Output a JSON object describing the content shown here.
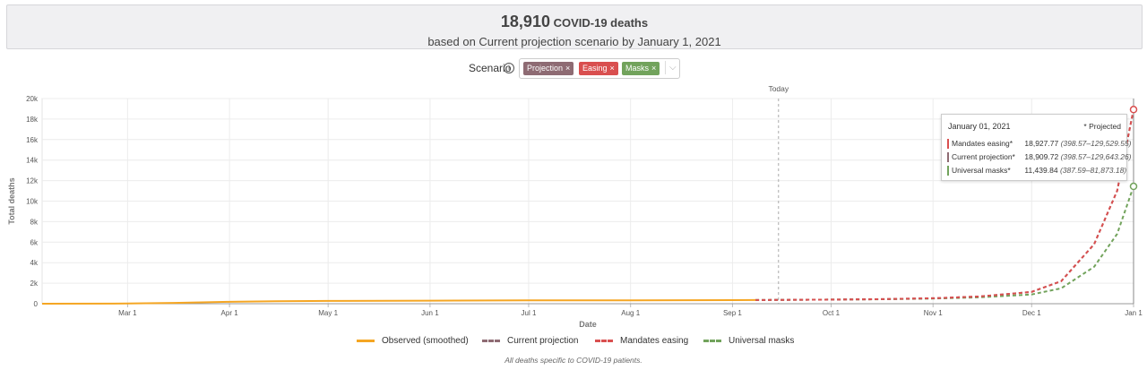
{
  "summary": {
    "value": "18,910",
    "metric": "COVID-19 deaths",
    "subtitle": "based on Current projection scenario by January 1, 2021"
  },
  "scenario": {
    "label": "Scenario",
    "info_icon": "info-icon",
    "tags": [
      {
        "label": "Projection",
        "color": "#8e6b73"
      },
      {
        "label": "Easing",
        "color": "#d94f4f"
      },
      {
        "label": "Masks",
        "color": "#72a35c"
      }
    ],
    "remove_glyph": "×",
    "dropdown_icon": "chevron-down-icon"
  },
  "tooltip": {
    "date": "January 01, 2021",
    "note": "* Projected",
    "rows": [
      {
        "name": "Mandates easing*",
        "value": "18,927.77",
        "ci": "(398.57–129,529.55)",
        "color": "#d94f4f"
      },
      {
        "name": "Current projection*",
        "value": "18,909.72",
        "ci": "(398.57–129,643.26)",
        "color": "#8e6b73"
      },
      {
        "name": "Universal masks*",
        "value": "11,439.84",
        "ci": "(387.59–81,873.18)",
        "color": "#72a35c"
      }
    ]
  },
  "legend": [
    {
      "label": "Observed (smoothed)",
      "color": "#f5a623",
      "style": "solid"
    },
    {
      "label": "Current projection",
      "color": "#8e6b73",
      "style": "dashed"
    },
    {
      "label": "Mandates easing",
      "color": "#d94f4f",
      "style": "dashed"
    },
    {
      "label": "Universal masks",
      "color": "#72a35c",
      "style": "dashed"
    }
  ],
  "footnote": "All deaths specific to COVID-19 patients.",
  "chart_data": {
    "type": "line",
    "xlabel": "Date",
    "ylabel": "Total deaths",
    "ylim": [
      0,
      20000
    ],
    "y_ticks": [
      "0",
      "2k",
      "4k",
      "6k",
      "8k",
      "10k",
      "12k",
      "14k",
      "16k",
      "18k",
      "20k"
    ],
    "x_tick_dates": [
      "2020-03-01",
      "2020-04-01",
      "2020-05-01",
      "2020-06-01",
      "2020-07-01",
      "2020-08-01",
      "2020-09-01",
      "2020-10-01",
      "2020-11-01",
      "2020-12-01",
      "2021-01-01"
    ],
    "x_tick_labels": [
      "Mar 1",
      "Apr 1",
      "May 1",
      "Jun 1",
      "Jul 1",
      "Aug 1",
      "Sep 1",
      "Oct 1",
      "Nov 1",
      "Dec 1",
      "Jan 1"
    ],
    "x_range": [
      "2020-02-04",
      "2021-01-01"
    ],
    "grid": true,
    "today": {
      "label": "Today",
      "date": "2020-09-15"
    },
    "series": [
      {
        "name": "Observed (smoothed)",
        "color": "#f5a623",
        "style": "solid",
        "x": [
          "2020-02-04",
          "2020-03-01",
          "2020-03-15",
          "2020-04-01",
          "2020-04-15",
          "2020-05-01",
          "2020-06-01",
          "2020-07-01",
          "2020-08-01",
          "2020-09-01",
          "2020-09-08"
        ],
        "y": [
          0,
          20,
          80,
          180,
          240,
          270,
          300,
          320,
          335,
          350,
          360
        ]
      },
      {
        "name": "Current projection",
        "color": "#8e6b73",
        "style": "dashed",
        "x": [
          "2020-09-08",
          "2020-10-01",
          "2020-10-15",
          "2020-11-01",
          "2020-11-15",
          "2020-12-01",
          "2020-12-10",
          "2020-12-20",
          "2020-12-27",
          "2021-01-01"
        ],
        "y": [
          360,
          400,
          440,
          530,
          700,
          1150,
          2200,
          5800,
          11000,
          18910
        ]
      },
      {
        "name": "Mandates easing",
        "color": "#d94f4f",
        "style": "dashed",
        "x": [
          "2020-09-08",
          "2020-10-01",
          "2020-10-15",
          "2020-11-01",
          "2020-11-15",
          "2020-12-01",
          "2020-12-10",
          "2020-12-20",
          "2020-12-27",
          "2021-01-01"
        ],
        "y": [
          360,
          400,
          440,
          530,
          700,
          1150,
          2200,
          5800,
          11000,
          18928
        ]
      },
      {
        "name": "Universal masks",
        "color": "#72a35c",
        "style": "dashed",
        "x": [
          "2020-09-08",
          "2020-10-01",
          "2020-10-15",
          "2020-11-01",
          "2020-11-15",
          "2020-12-01",
          "2020-12-10",
          "2020-12-20",
          "2020-12-27",
          "2021-01-01"
        ],
        "y": [
          360,
          400,
          430,
          500,
          620,
          900,
          1500,
          3600,
          6800,
          11440
        ]
      }
    ]
  }
}
